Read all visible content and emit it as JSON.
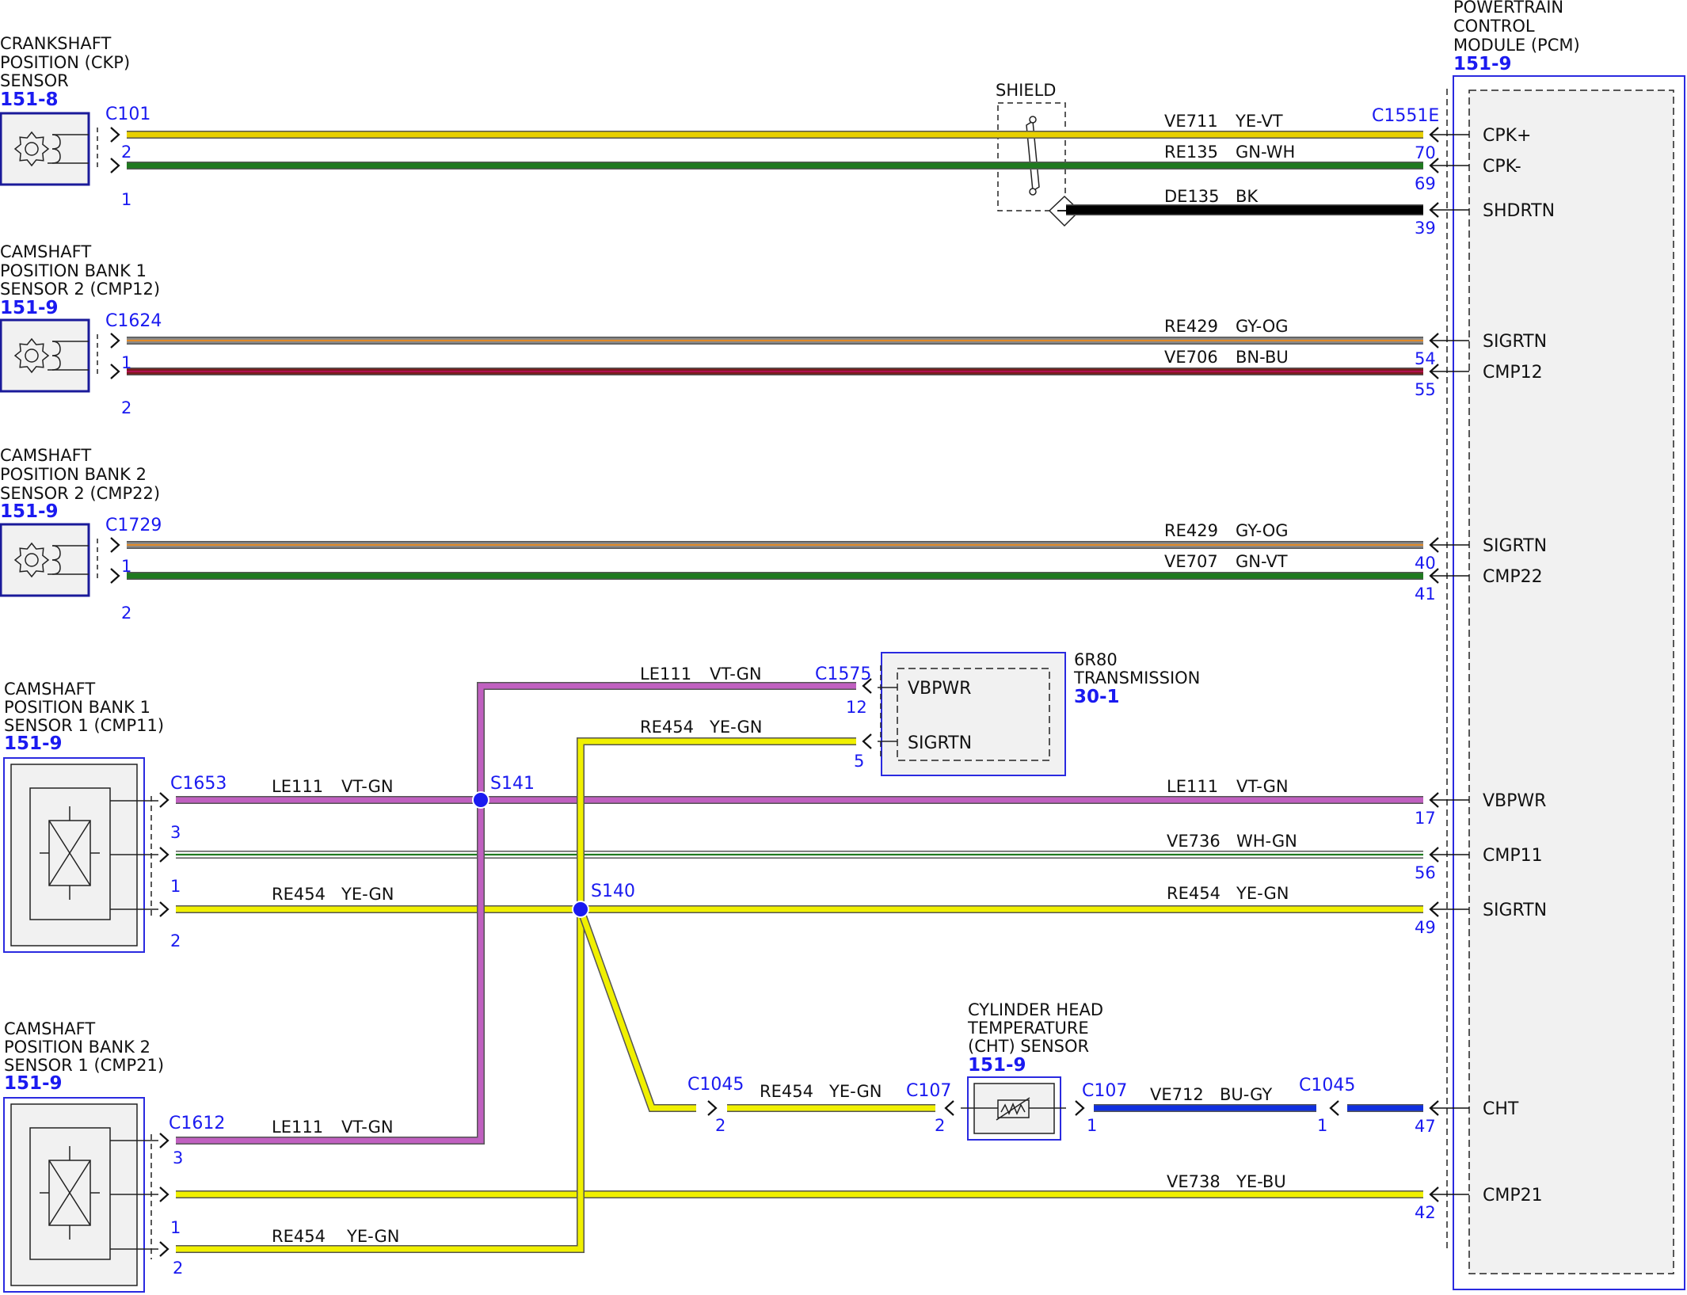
{
  "components": {
    "ckp": {
      "lines": [
        "CRANKSHAFT",
        "POSITION (CKP)",
        "SENSOR"
      ],
      "ref": "151-8",
      "connector": "C101"
    },
    "cmp12": {
      "lines": [
        "CAMSHAFT",
        "POSITION BANK 1",
        "SENSOR 2 (CMP12)"
      ],
      "ref": "151-9",
      "connector": "C1624"
    },
    "cmp22": {
      "lines": [
        "CAMSHAFT",
        "POSITION BANK 2",
        "SENSOR 2 (CMP22)"
      ],
      "ref": "151-9",
      "connector": "C1729"
    },
    "cmp11": {
      "lines": [
        "CAMSHAFT",
        "POSITION BANK 1",
        "SENSOR 1 (CMP11)"
      ],
      "ref": "151-9",
      "connector": "C1653"
    },
    "cmp21": {
      "lines": [
        "CAMSHAFT",
        "POSITION BANK 2",
        "SENSOR 1 (CMP21)"
      ],
      "ref": "151-9",
      "connector": "C1612"
    },
    "pcm": {
      "lines": [
        "POWERTRAIN",
        "CONTROL",
        "MODULE (PCM)"
      ],
      "ref": "151-9",
      "connector": "C1551E"
    },
    "trans": {
      "lines": [
        "6R80",
        "TRANSMISSION"
      ],
      "ref": "30-1",
      "connector": "C1575",
      "pins": [
        "VBPWR",
        "SIGRTN"
      ]
    },
    "cht": {
      "lines": [
        "CYLINDER HEAD",
        "TEMPERATURE",
        "(CHT) SENSOR"
      ],
      "ref": "151-9"
    }
  },
  "shield_label": "SHIELD",
  "splices": [
    "S141",
    "S140"
  ],
  "inline_connectors": [
    "C1045",
    "C107",
    "C107",
    "C1045"
  ],
  "wires": [
    {
      "id": "w-ckp-plus",
      "circuit": "VE711",
      "color": "YE-VT",
      "from_pin": "2",
      "pcm_pin": "70",
      "pcm_name": "CPK+",
      "colors": [
        "#e8d000",
        "#e8d000"
      ]
    },
    {
      "id": "w-ckp-minus",
      "circuit": "RE135",
      "color": "GN-WH",
      "from_pin": "1",
      "pcm_pin": "69",
      "pcm_name": "CPK-",
      "colors": [
        "#1f7a1f",
        "#1f7a1f"
      ]
    },
    {
      "id": "w-shield",
      "circuit": "DE135",
      "color": "BK",
      "from_pin": "",
      "pcm_pin": "39",
      "pcm_name": "SHDRTN",
      "colors": [
        "#000000",
        "#000000"
      ]
    },
    {
      "id": "w-cmp12-sig",
      "circuit": "RE429",
      "color": "GY-OG",
      "from_pin": "1",
      "pcm_pin": "54",
      "pcm_name": "SIGRTN",
      "colors": [
        "#8a8a8a",
        "#e08a2a"
      ]
    },
    {
      "id": "w-cmp12",
      "circuit": "VE706",
      "color": "BN-BU",
      "from_pin": "2",
      "pcm_pin": "55",
      "pcm_name": "CMP12",
      "colors": [
        "#7a1a1a",
        "#b01050"
      ]
    },
    {
      "id": "w-cmp22-sig",
      "circuit": "RE429",
      "color": "GY-OG",
      "from_pin": "1",
      "pcm_pin": "40",
      "pcm_name": "SIGRTN",
      "colors": [
        "#8a8a8a",
        "#e08a2a"
      ]
    },
    {
      "id": "w-cmp22",
      "circuit": "VE707",
      "color": "GN-VT",
      "from_pin": "2",
      "pcm_pin": "41",
      "pcm_name": "CMP22",
      "colors": [
        "#1f7a1f",
        "#1f7a1f"
      ]
    },
    {
      "id": "w-cmp11-pwr",
      "circuit": "LE111",
      "color": "VT-GN",
      "from_pin": "3",
      "pcm_pin": "17",
      "pcm_name": "VBPWR",
      "colors": [
        "#c060c0",
        "#c060c0"
      ]
    },
    {
      "id": "w-cmp11",
      "circuit": "VE736",
      "color": "WH-GN",
      "from_pin": "1",
      "pcm_pin": "56",
      "pcm_name": "CMP11",
      "colors": [
        "#ffffff",
        "#1f7a1f"
      ]
    },
    {
      "id": "w-cmp11-sig",
      "circuit": "RE454",
      "color": "YE-GN",
      "from_pin": "2",
      "pcm_pin": "49",
      "pcm_name": "SIGRTN",
      "colors": [
        "#f0f000",
        "#f0f000"
      ]
    },
    {
      "id": "w-cht",
      "circuit": "VE712",
      "color": "BU-GY",
      "from_pin": "1",
      "pcm_pin": "47",
      "pcm_name": "CHT",
      "colors": [
        "#1030e0",
        "#1030e0"
      ]
    },
    {
      "id": "w-cmp21",
      "circuit": "VE738",
      "color": "YE-BU",
      "from_pin": "1",
      "pcm_pin": "42",
      "pcm_name": "CMP21",
      "colors": [
        "#f0f000",
        "#f0f000"
      ]
    }
  ],
  "branch_labels": {
    "trans_pwr": {
      "circuit": "LE111",
      "color": "VT-GN",
      "pin": "12"
    },
    "trans_sig": {
      "circuit": "RE454",
      "color": "YE-GN",
      "pin": "5"
    },
    "cmp11_pwr_left": {
      "circuit": "LE111",
      "color": "VT-GN"
    },
    "cmp11_sig_left": {
      "circuit": "RE454",
      "color": "YE-GN"
    },
    "cht_sig": {
      "circuit": "RE454",
      "color": "YE-GN",
      "pin_a": "2",
      "pin_b": "2"
    },
    "cmp21_pwr": {
      "circuit": "LE111",
      "color": "VT-GN",
      "pin": "3"
    },
    "cmp21_sig": {
      "circuit": "RE454",
      "color": "YE-GN",
      "pin": "2"
    },
    "cht_out_pins": [
      "1",
      "1"
    ]
  }
}
